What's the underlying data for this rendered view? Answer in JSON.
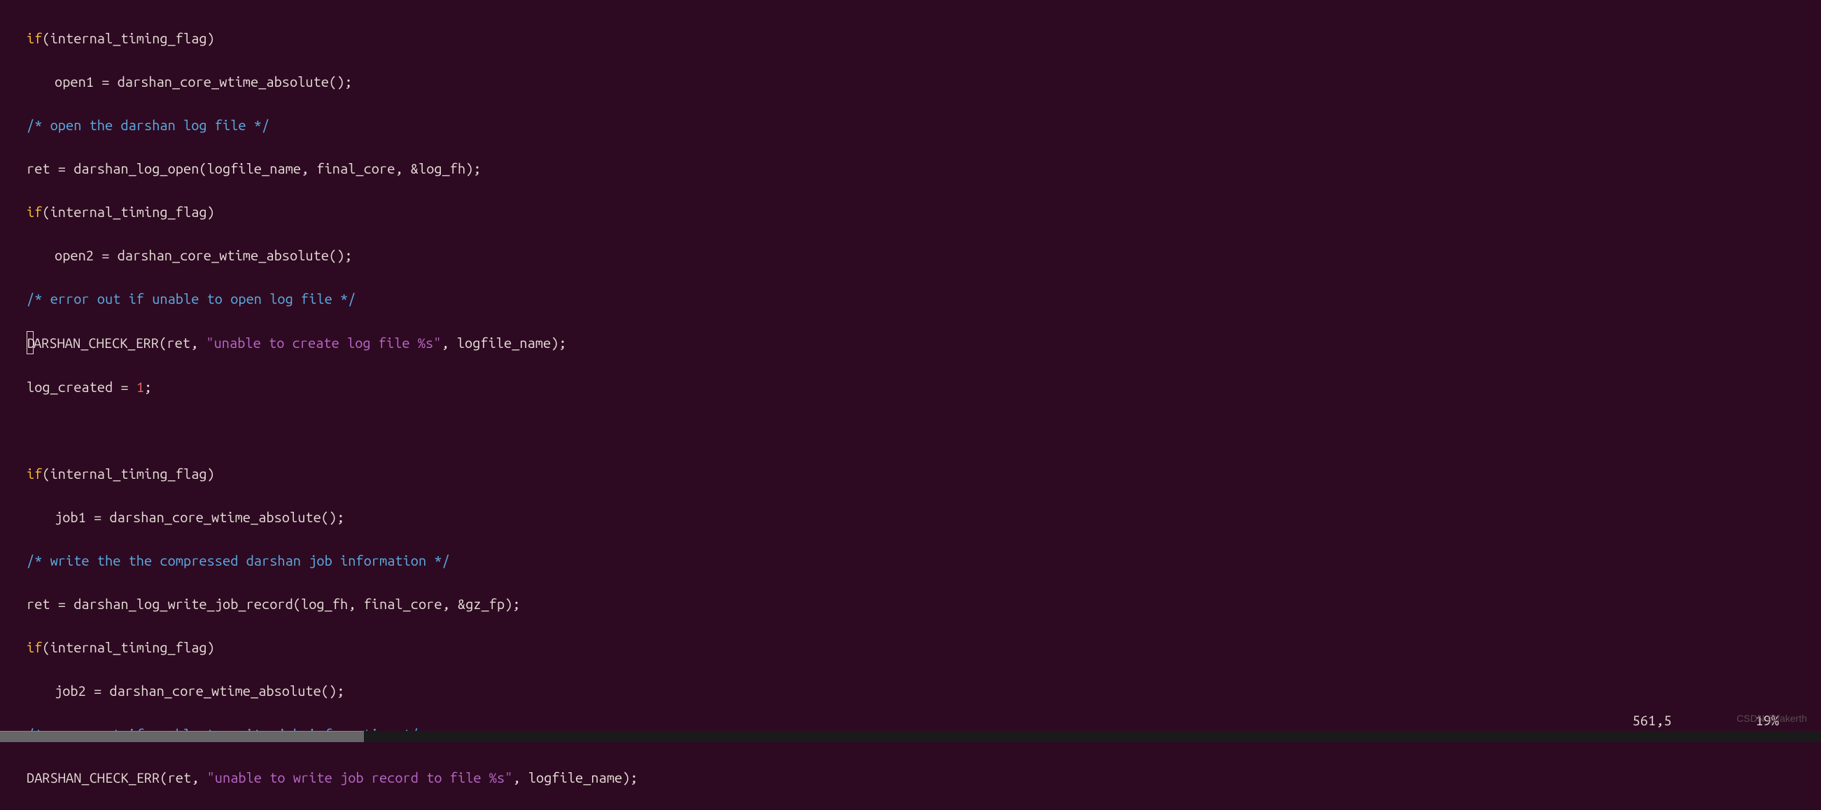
{
  "code": {
    "l1_kw": "if",
    "l1_rest": "(internal_timing_flag)",
    "l2": "open1 = darshan_core_wtime_absolute();",
    "l3_comment": "/* open the darshan log file */",
    "l4": "ret = darshan_log_open(logfile_name, final_core, &log_fh);",
    "l5_kw": "if",
    "l5_rest": "(internal_timing_flag)",
    "l6": "open2 = darshan_core_wtime_absolute();",
    "l7_comment": "/* error out if unable to open log file */",
    "l8_cursor": "D",
    "l8_a": "ARSHAN_CHECK_ERR(ret, ",
    "l8_str": "\"unable to create log file %s\"",
    "l8_b": ", logfile_name);",
    "l9_a": "log_created = ",
    "l9_num": "1",
    "l9_b": ";",
    "l11_kw": "if",
    "l11_rest": "(internal_timing_flag)",
    "l12": "job1 = darshan_core_wtime_absolute();",
    "l13_comment": "/* write the the compressed darshan job information */",
    "l14": "ret = darshan_log_write_job_record(log_fh, final_core, &gz_fp);",
    "l15_kw": "if",
    "l15_rest": "(internal_timing_flag)",
    "l16": "job2 = darshan_core_wtime_absolute();",
    "l17_comment": "/* error out if unable to write job information */",
    "l18_a": "DARSHAN_CHECK_ERR(ret, ",
    "l18_str": "\"unable to write job record to file %s\"",
    "l18_b": ", logfile_name);"
  },
  "status": {
    "position": "561,5",
    "percent": "19%"
  },
  "watermark": "CSDN @fakerth"
}
